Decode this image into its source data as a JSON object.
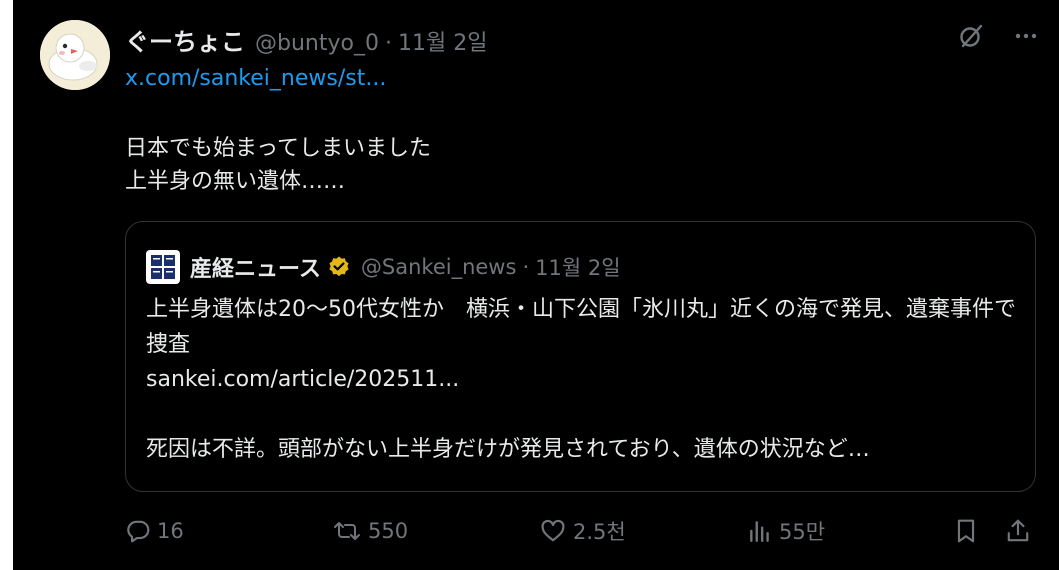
{
  "post": {
    "author": {
      "display_name": "ぐーちょこ",
      "handle": "@buntyo_0",
      "date": "11월 2일"
    },
    "separator": "·",
    "link": "x.com/sankei_news/st...",
    "text": "日本でも始まってしまいました\n上半身の無い遺体……"
  },
  "quote": {
    "display_name": "産経ニュース",
    "handle": "@Sankei_news",
    "date": "11월 2일",
    "text": "上半身遺体は20〜50代女性か　横浜・山下公園「氷川丸」近くの海で発見、遺棄事件で捜査",
    "link": "sankei.com/article/202511...",
    "excerpt": "死因は不詳。頭部がない上半身だけが発見されており、遺体の状況など…"
  },
  "actions": {
    "replies": "16",
    "reposts": "550",
    "likes": "2.5천",
    "views": "55만"
  },
  "icons": {
    "grok": "slashed-circle-icon",
    "more": "more-icon",
    "verified": "verified-badge-icon",
    "reply": "reply-icon",
    "repost": "repost-icon",
    "like": "heart-icon",
    "views": "views-icon",
    "bookmark": "bookmark-icon",
    "share": "share-icon"
  },
  "colors": {
    "background": "#000000",
    "text": "#e7e9ea",
    "secondary": "#71767b",
    "link": "#1d9bf0",
    "verified": "#e2b719",
    "border": "#2f3336"
  }
}
